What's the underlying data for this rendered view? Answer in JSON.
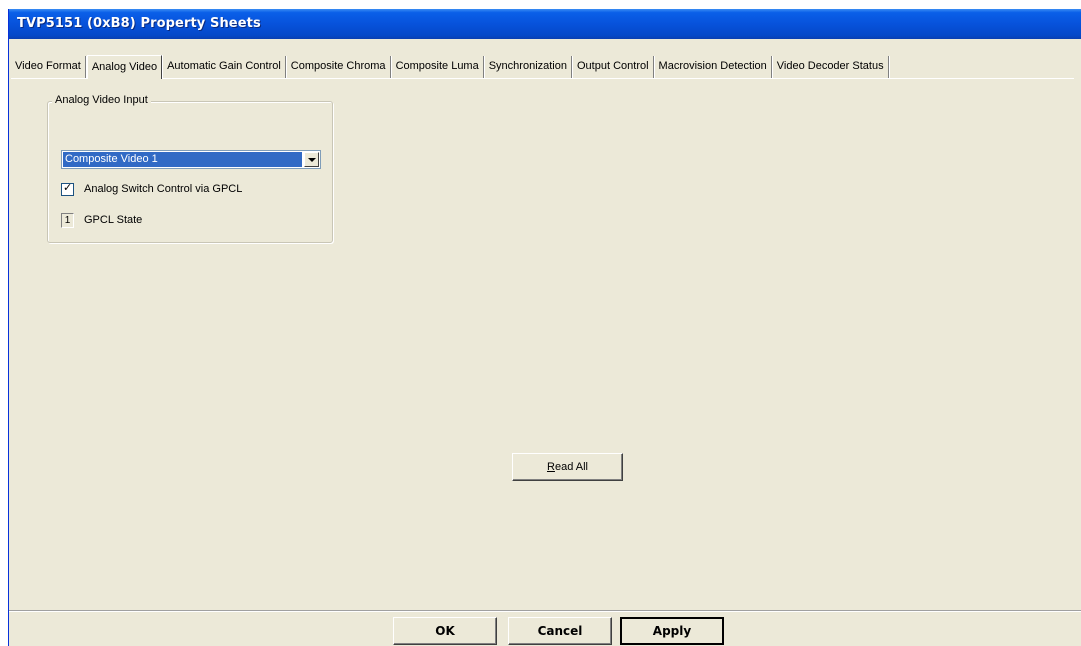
{
  "window": {
    "title": "TVP5151 (0xB8) Property Sheets"
  },
  "tabs": [
    {
      "label": "Video Format",
      "active": false
    },
    {
      "label": "Analog Video",
      "active": true
    },
    {
      "label": "Automatic Gain Control",
      "active": false
    },
    {
      "label": "Composite Chroma",
      "active": false
    },
    {
      "label": "Composite Luma",
      "active": false
    },
    {
      "label": "Synchronization",
      "active": false
    },
    {
      "label": "Output Control",
      "active": false
    },
    {
      "label": "Macrovision Detection",
      "active": false
    },
    {
      "label": "Video Decoder Status",
      "active": false
    }
  ],
  "analog_video_input": {
    "group_label": "Analog Video Input",
    "selected_input": "Composite Video 1",
    "switch_control": {
      "label": "Analog Switch Control via GPCL",
      "checked": true,
      "check_glyph": "✓"
    },
    "gpcl_state": {
      "label": "GPCL State",
      "value": "1"
    }
  },
  "read_all": {
    "prefix": "R",
    "rest": "ead All"
  },
  "dialog_buttons": {
    "ok": "OK",
    "cancel": "Cancel",
    "apply": "Apply"
  },
  "colors": {
    "titlebar": "#0752db",
    "window_bg": "#ece9d8",
    "selection": "#316ac5"
  },
  "icons": {
    "dropdown": "chevron-down-icon",
    "check": "check-icon"
  }
}
